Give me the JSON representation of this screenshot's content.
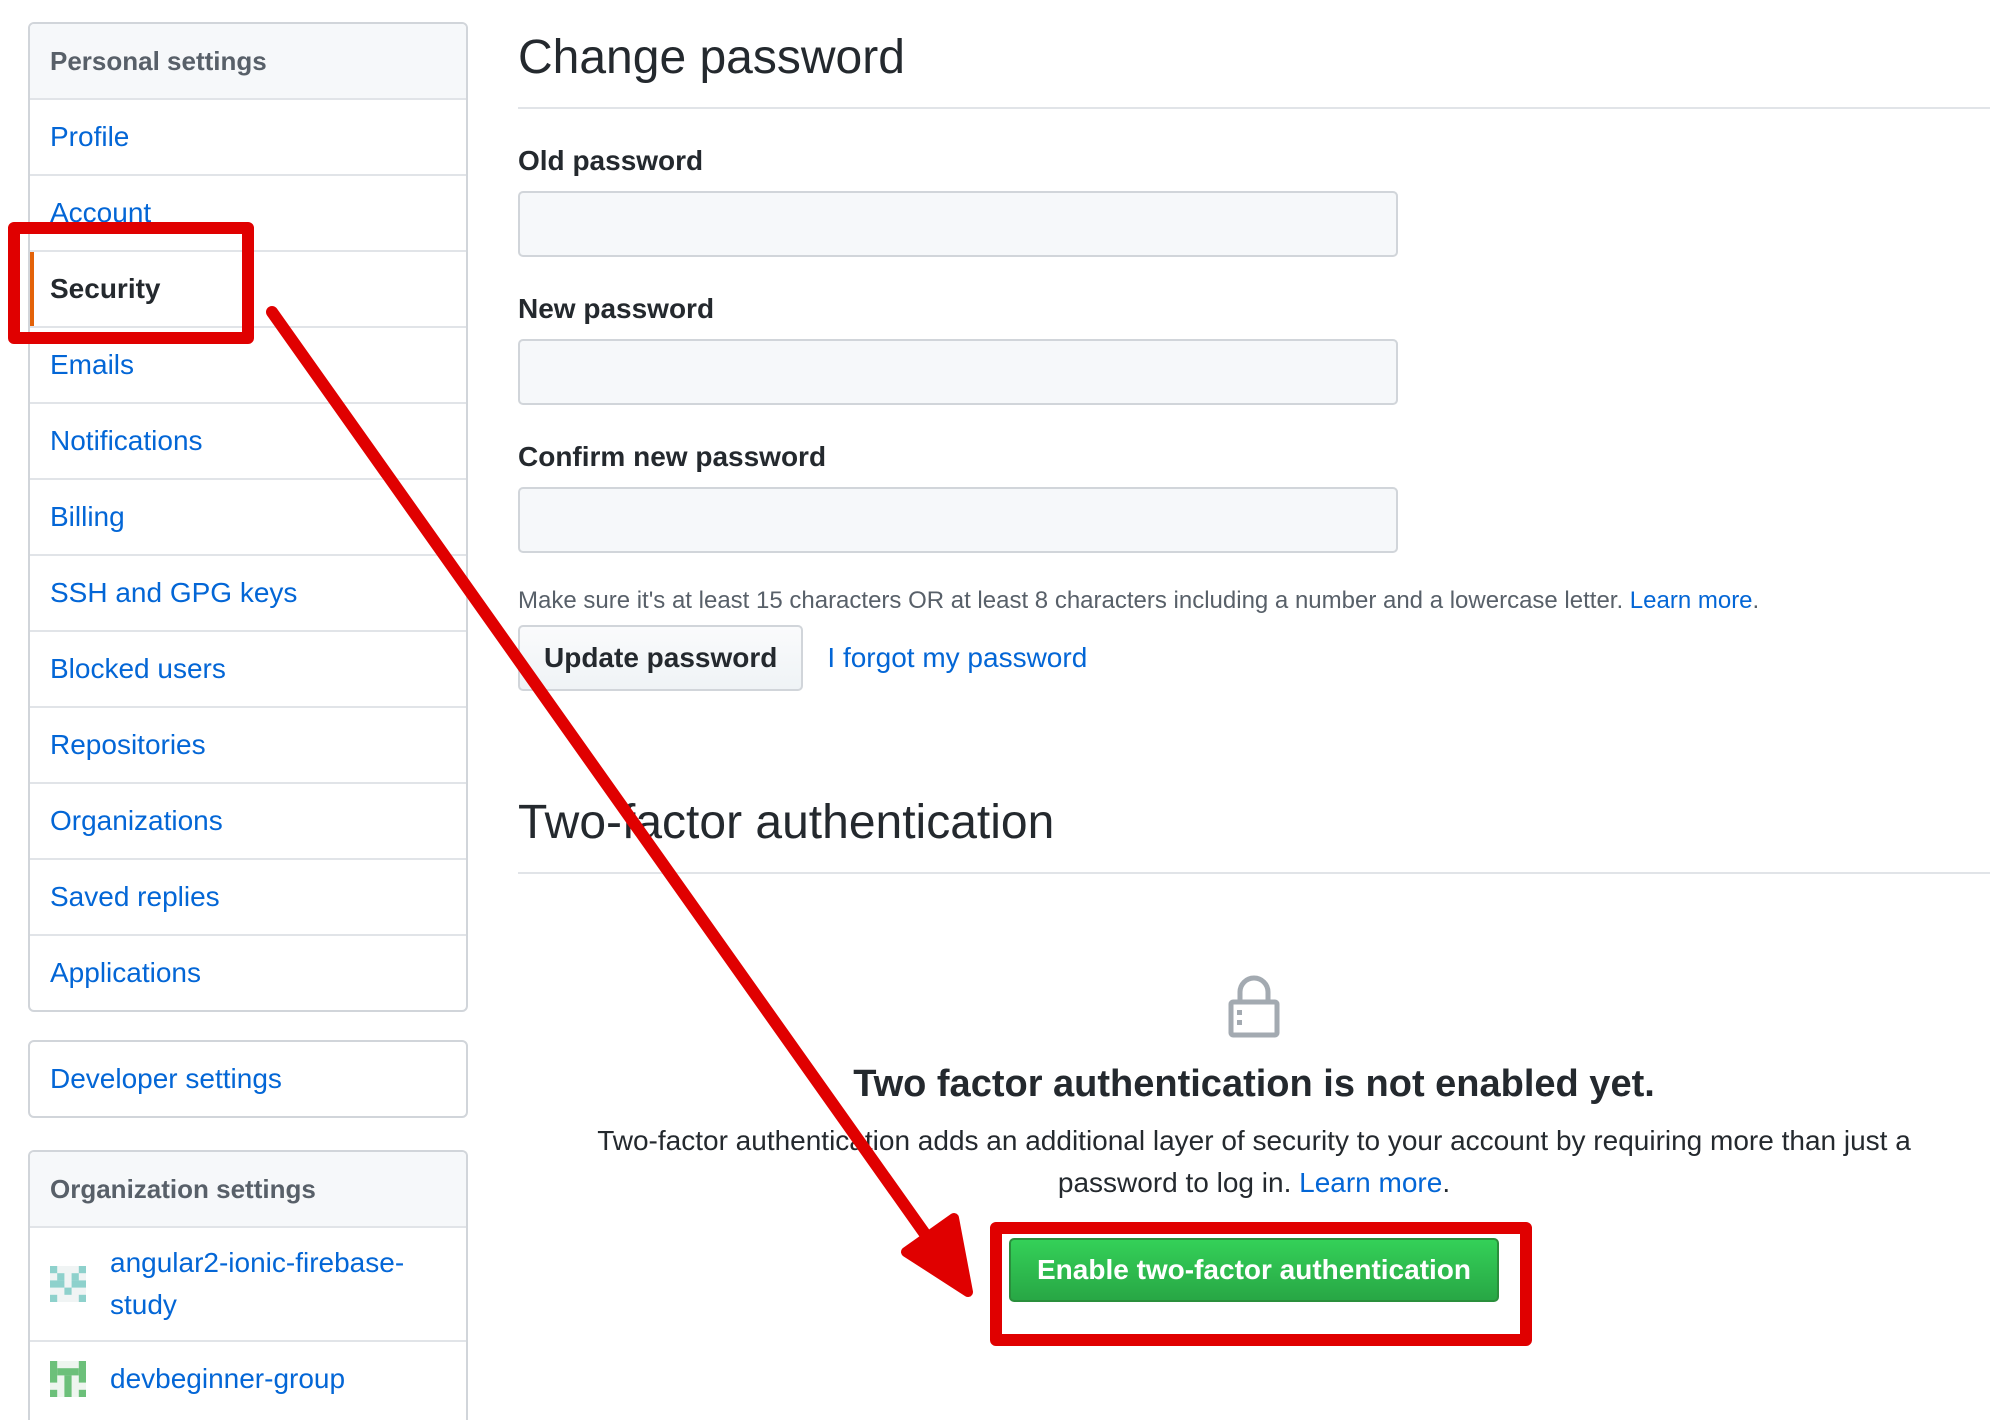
{
  "sidebar": {
    "personal_heading": "Personal settings",
    "items": [
      {
        "label": "Profile"
      },
      {
        "label": "Account"
      },
      {
        "label": "Security",
        "selected": true
      },
      {
        "label": "Emails"
      },
      {
        "label": "Notifications"
      },
      {
        "label": "Billing"
      },
      {
        "label": "SSH and GPG keys"
      },
      {
        "label": "Blocked users"
      },
      {
        "label": "Repositories"
      },
      {
        "label": "Organizations"
      },
      {
        "label": "Saved replies"
      },
      {
        "label": "Applications"
      }
    ],
    "developer_settings": "Developer settings",
    "org_heading": "Organization settings",
    "orgs": [
      {
        "label": "angular2-ionic-firebase-study"
      },
      {
        "label": "devbeginner-group"
      }
    ]
  },
  "change_password": {
    "title": "Change password",
    "old_label": "Old password",
    "new_label": "New password",
    "confirm_label": "Confirm new password",
    "old_value": "",
    "new_value": "",
    "confirm_value": "",
    "note": "Make sure it's at least 15 characters OR at least 8 characters including a number and a lowercase letter.",
    "note_link": "Learn more",
    "update_button": "Update password",
    "forgot_link": "I forgot my password"
  },
  "two_factor": {
    "title": "Two-factor authentication",
    "icon": "lock-icon",
    "blank_title": "Two factor authentication is not enabled yet.",
    "description": "Two-factor authentication adds an additional layer of security to your account by requiring more than just a password to log in.",
    "learn_more": "Learn more",
    "enable_button": "Enable two-factor authentication"
  },
  "colors": {
    "link": "#0366d6",
    "primary_button": "#28a745",
    "annotation": "#e00000",
    "selected_marker": "#e36209"
  }
}
